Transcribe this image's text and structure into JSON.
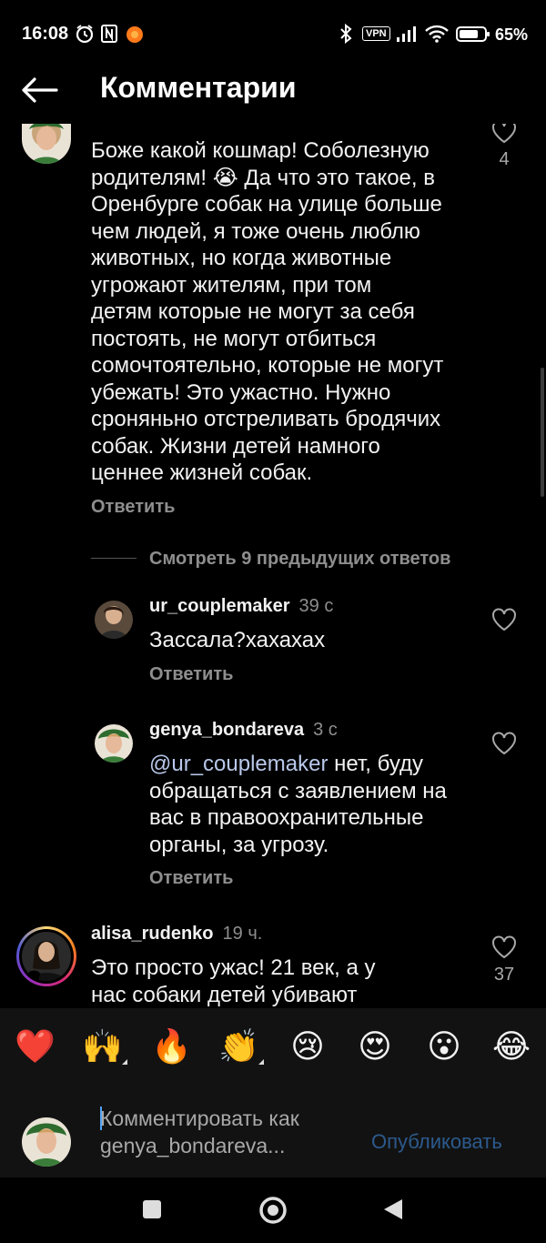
{
  "status_bar": {
    "time": "16:08",
    "battery_percent": "65%",
    "vpn_label": "VPN"
  },
  "header": {
    "title": "Комментарии"
  },
  "comments": [
    {
      "text_lines": [
        "Боже какой кошмар! Соболезную",
        "родителям! 😭 Да что это такое, в",
        "Оренбурге собак на улице больше",
        "чем людей, я тоже очень люблю",
        "животных, но когда животные",
        "угрожают жителям, при том",
        "детям которые не могут за себя",
        "постоять, не могут отбиться",
        "сомочтоятельно, которые не могут",
        "убежать! Это ужастно. Нужно",
        "сроняньно отстреливать бродячих",
        "собак. Жизни детей намного",
        "ценнее жизней собак."
      ],
      "likes": "4",
      "reply_label": "Ответить",
      "view_replies": "Смотреть 9 предыдущих ответов",
      "replies": [
        {
          "username": "ur_couplemaker",
          "time": "39 с",
          "text": "Зассала?хахахах",
          "reply_label": "Ответить"
        },
        {
          "username": "genya_bondareva",
          "time": "3 с",
          "mention": "@ur_couplemaker",
          "text_lines": [
            " нет, буду",
            "обращаться с заявлением на",
            "вас в правоохранительные",
            "органы, за угрозу."
          ],
          "reply_label": "Ответить"
        }
      ]
    },
    {
      "username": "alisa_rudenko",
      "time": "19 ч.",
      "text_lines": [
        "Это просто ужас! 21 век, а у",
        "нас собаки детей убивают"
      ],
      "likes": "37"
    }
  ],
  "emoji_bar": [
    "❤️",
    "🙌",
    "🔥",
    "👏",
    "😢",
    "😍",
    "😮",
    "😂"
  ],
  "comment_input": {
    "placeholder_line1": "Комментировать как",
    "placeholder_line2": "genya_bondareva...",
    "publish_label": "Опубликовать"
  },
  "colors": {
    "background": "#000000",
    "secondary_text": "#8e8e8e",
    "publish_disabled": "#2c5a8c",
    "story_ring": "#c13584"
  }
}
